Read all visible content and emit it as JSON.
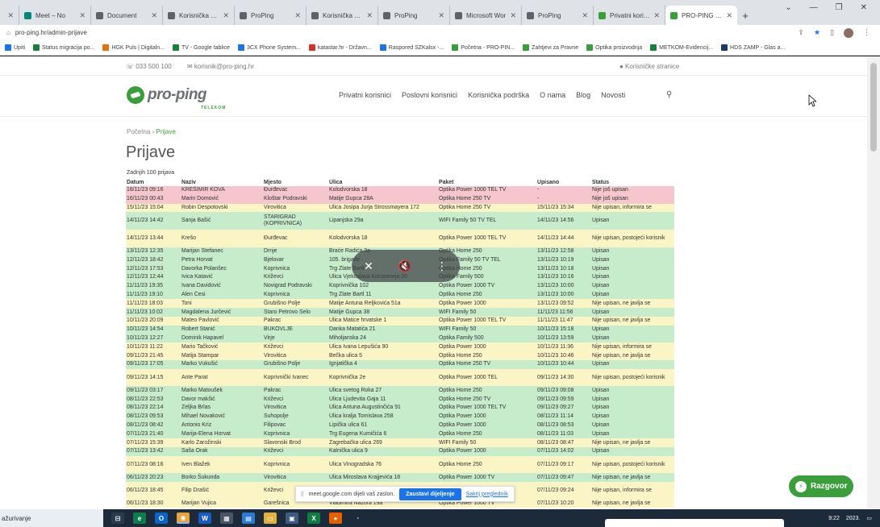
{
  "tabs": [
    {
      "title": "",
      "color": "#5f6368"
    },
    {
      "title": "Meet – No",
      "color": "#00897b"
    },
    {
      "title": "Document",
      "color": "#5f6368"
    },
    {
      "title": "Korisnička pod",
      "color": "#5f6368"
    },
    {
      "title": "ProPing",
      "color": "#5f6368"
    },
    {
      "title": "Korisnička pod",
      "color": "#5f6368"
    },
    {
      "title": "ProPing",
      "color": "#5f6368"
    },
    {
      "title": "Microsoft Wor",
      "color": "#5f6368"
    },
    {
      "title": "ProPing",
      "color": "#5f6368"
    },
    {
      "title": "Privatni korisni",
      "color": "#3a9e3a"
    },
    {
      "title": "PRO-PING Tele",
      "color": "#3a9e3a",
      "active": true
    }
  ],
  "address": {
    "url": "pro-ping.hr/admin-prijave"
  },
  "bookmarks": [
    {
      "label": "Upiti",
      "color": "#1a73e8"
    },
    {
      "label": "Status migracija po...",
      "color": "#188038"
    },
    {
      "label": "HGK Puls | Digitaln...",
      "color": "#e8710a"
    },
    {
      "label": "TV - Google tablice",
      "color": "#188038"
    },
    {
      "label": "3CX Phone System...",
      "color": "#1a73e8"
    },
    {
      "label": "katastar.hr - Državn...",
      "color": "#d93025"
    },
    {
      "label": "Raspored SZKalsx -...",
      "color": "#1a73e8"
    },
    {
      "label": "Početna - PRO-PIN...",
      "color": "#3a9e3a"
    },
    {
      "label": "Zahtjevi za Pravne",
      "color": "#3a9e3a"
    },
    {
      "label": "Optika proizvodnja",
      "color": "#3a9e3a"
    },
    {
      "label": "METKOM-Evidencij...",
      "color": "#188038"
    },
    {
      "label": "HDS ZAMP - Glas a...",
      "color": "#1a3a6a"
    }
  ],
  "topinfo": {
    "phone": "☏ 033 500 100",
    "email": "✉ korisnik@pro-ping.hr",
    "account": "● Korisničke stranice"
  },
  "logo": {
    "word": "pro-ping",
    "sub": "TELEKOM"
  },
  "nav": [
    "Privatni korisnici",
    "Poslovni korisnici",
    "Korisnička podrška",
    "O nama",
    "Blog",
    "Novosti"
  ],
  "breadcrumb": {
    "home": "Početna",
    "sep": "›",
    "current": "Prijave"
  },
  "page_title": "Prijave",
  "count_label": "Zadnjih 100 prijava",
  "columns": [
    "Datum",
    "Naziv",
    "Mjesto",
    "Ulica",
    "Paket",
    "Upisano",
    "Status"
  ],
  "rows": [
    {
      "c": "red",
      "v": [
        "16/11/23 09:16",
        "KREŠIMIR KOVA",
        "Đurđevac",
        "Kolodvorska 18",
        "Optika Power 1000 TEL TV",
        "-",
        "Nije još upisan"
      ]
    },
    {
      "c": "red",
      "v": [
        "16/11/23 00:43",
        "Marin Domović",
        "Kloštar Podravski",
        "Matije Gupca 28A",
        "Optika Home 250 TV",
        "-",
        "Nije još upisan"
      ]
    },
    {
      "c": "yellow",
      "v": [
        "15/11/23 15:04",
        "Robin Despotovski",
        "Virovitica",
        "Ulica Josipa Jurja Strossmayera 172",
        "Optika Home 250 TV",
        "15/11/23 15:34",
        "Nije upisan, informira se"
      ]
    },
    {
      "c": "green",
      "tall": true,
      "v": [
        "14/11/23 14:42",
        "Sanja Bašić",
        "STARIGRAD (KOPRIVNICA)",
        "Lipanjska 29a",
        "WIFI Family 50 TV TEL",
        "14/11/23 14:56",
        "Upisan"
      ]
    },
    {
      "c": "yellow",
      "tall": true,
      "v": [
        "14/11/23 13:44",
        "Krešo",
        "Đurđevac",
        "Kolodvorska 18",
        "Optika Power 1000 TEL TV",
        "14/11/23 14:44",
        "Nije upisan, postojeći korisnik"
      ]
    },
    {
      "c": "green",
      "v": [
        "13/11/23 12:35",
        "Marijan Štefanec",
        "Drnje",
        "Braće Radića 2a",
        "Optika Home 250",
        "13/11/23 12:58",
        "Upisan"
      ]
    },
    {
      "c": "green",
      "v": [
        "12/11/23 18:42",
        "Petra Horvat",
        "Bjelovar",
        "105. brigade",
        "Optika Family 50 TV TEL",
        "13/11/23 10:19",
        "Upisan"
      ]
    },
    {
      "c": "green",
      "v": [
        "12/11/23 17:53",
        "Davorka Polanšec",
        "Koprivnica",
        "Trg Zlate Bartl",
        "Optika Home 250",
        "13/11/23 10:18",
        "Upisan"
      ]
    },
    {
      "c": "green",
      "v": [
        "12/11/23 12:44",
        "Ivica Katavić",
        "Križevci",
        "Ulica Vjekoslava Koroseneja 20",
        "Optika Family 500",
        "13/11/23 10:16",
        "Upisan"
      ]
    },
    {
      "c": "green",
      "v": [
        "11/11/23 19:35",
        "Ivana Davidović",
        "Novigrad Podravski",
        "Koprivnička 102",
        "Optika Power 1000 TV",
        "13/11/23 10:00",
        "Upisan"
      ]
    },
    {
      "c": "green",
      "v": [
        "11/11/23 19:10",
        "Alen Česi",
        "Koprivnica",
        "Trg Zlate Bartl 11",
        "Optika Home 250",
        "13/11/23 10:00",
        "Upisan"
      ]
    },
    {
      "c": "yellow",
      "v": [
        "11/11/23 18:03",
        "Toni",
        "Grubišno Polje",
        "Matije Antuna Reljkovića 51a",
        "Optika Power 1000",
        "13/11/23 09:52",
        "Nije upisan, ne javlja se"
      ]
    },
    {
      "c": "green",
      "v": [
        "11/11/23 10:02",
        "Magdalena Jurčević",
        "Staro Petrovo Selo",
        "Matije Gupca 38",
        "WIFI Family 50",
        "11/11/23 11:56",
        "Upisan"
      ]
    },
    {
      "c": "yellow",
      "v": [
        "10/11/23 20:09",
        "Mateo Pavlović",
        "Pakrac",
        "Ulica Matice hrvatske 1",
        "Optika Power 1000 TEL TV",
        "11/11/23 11:47",
        "Nije upisan, ne javlja se"
      ]
    },
    {
      "c": "green",
      "v": [
        "10/11/23 14:54",
        "Robert Stanić",
        "BUKOVLJE",
        "Danka Matatića 21",
        "WIFI Family 50",
        "10/11/23 15:18",
        "Upisan"
      ]
    },
    {
      "c": "green",
      "v": [
        "10/11/23 12:27",
        "Dominik Hapavel",
        "Virje",
        "Miholjanska 24",
        "Optika Family 500",
        "10/11/23 13:59",
        "Upisan"
      ]
    },
    {
      "c": "yellow",
      "v": [
        "10/11/23 11:22",
        "Mario Tačković",
        "Križevci",
        "Ulica Ivana Lepušića 90",
        "Optika Power 1000",
        "10/11/23 11:36",
        "Nije upisan, informira se"
      ]
    },
    {
      "c": "yellow",
      "v": [
        "09/11/23 21:45",
        "Matija Stampar",
        "Virovitica",
        "Bečka ulica 5",
        "Optika Home 250",
        "10/11/23 10:46",
        "Nije upisan, ne javlja se"
      ]
    },
    {
      "c": "green",
      "v": [
        "09/11/23 17:05",
        "Marko Vukušić",
        "Grubišno Polje",
        "Ignjatička 4",
        "Optika Home 250 TV",
        "10/11/23 10:44",
        "Upisan"
      ]
    },
    {
      "c": "yellow",
      "tall": true,
      "v": [
        "09/11/23 14:15",
        "Ante Parat",
        "Koprivnički Ivanec",
        "Koprivnička 2e",
        "Optika Power 1000 TEL",
        "09/11/23 14:30",
        "Nije upisan, postojeći korisnik"
      ]
    },
    {
      "c": "green",
      "v": [
        "09/11/23 03:17",
        "Marko Matoušek",
        "Pakrac",
        "Ulica svetog Roka 27",
        "Optika Home 250",
        "09/11/23 09:08",
        "Upisan"
      ]
    },
    {
      "c": "green",
      "v": [
        "08/11/23 22:53",
        "Davor makšić",
        "Križevci",
        "Ulica Ljudevita Gaja 11",
        "Optika Home 250 TV",
        "09/11/23 09:59",
        "Upisan"
      ]
    },
    {
      "c": "green",
      "v": [
        "08/11/23 22:14",
        "Zeljka Brlas",
        "Virovitica",
        "Ulica Antuna Augustinčića 91",
        "Optika Power 1000 TEL TV",
        "09/11/23 09:27",
        "Upisan"
      ]
    },
    {
      "c": "green",
      "v": [
        "08/11/23 09:53",
        "Mihael Novaković",
        "Suhopolje",
        "Ulica kralja Tomislava 258",
        "Optika Power 1000",
        "08/11/23 11:14",
        "Upisan"
      ]
    },
    {
      "c": "green",
      "v": [
        "08/11/23 08:42",
        "Antonio Kriz",
        "Filipovac",
        "Lipička ulica 61",
        "Optika Power 1000",
        "08/11/23 08:53",
        "Upisan"
      ]
    },
    {
      "c": "green",
      "v": [
        "07/11/23 21:40",
        "Marija-Elena Horvat",
        "Koprivnica",
        "Trg Eugena Kumičića 6",
        "Optika Home 250",
        "08/11/23 11:03",
        "Upisan"
      ]
    },
    {
      "c": "yellow",
      "v": [
        "07/11/23 15:39",
        "Karlo Zarožinski",
        "Slavonski Brod",
        "Zagrebačka ulica 269",
        "WIFI Family 50",
        "08/11/23 08:47",
        "Nije upisan, ne javlja se"
      ]
    },
    {
      "c": "green",
      "v": [
        "07/11/23 13:42",
        "Saša Orak",
        "Križevci",
        "Kalnička ulica 9",
        "Optika Power 1000",
        "07/11/23 14:02",
        "Upisan"
      ]
    },
    {
      "c": "yellow",
      "tall": true,
      "v": [
        "07/11/23 08:16",
        "Iven Blažek",
        "Koprivnica",
        "Ulica Vinogradska 76",
        "Optika Home 250",
        "07/11/23 09:17",
        "Nije upisan, postojeći korisnik"
      ]
    },
    {
      "c": "green",
      "v": [
        "06/11/23 20:23",
        "Borko Šukunda",
        "Virovitica",
        "Ulica Miroslava Krajjevića 18",
        "Optika Power 1000 TV",
        "07/11/23 09:47",
        "Nije upisan, ne javlja se"
      ]
    },
    {
      "c": "yellow",
      "tall": true,
      "v": [
        "06/11/23 18:45",
        "Filip Drašić",
        "Križevci",
        "",
        "Optika Power 1000",
        "07/11/23 09:24",
        "Nije upisan, informira se"
      ]
    },
    {
      "c": "yellow",
      "v": [
        "06/11/23 18:30",
        "Marijan Vujica",
        "Garešnica",
        "Vladimira Nazora 19a",
        "Optika Power 1000 TV",
        "07/11/23 10:20",
        "Nije upisan, ne javlja se"
      ]
    }
  ],
  "share_bar": {
    "text": "meet.google.com dijeli vaš zaslon.",
    "stop": "Zaustavi dijeljenje",
    "hide": "Sakrij pregledník"
  },
  "chat": {
    "label": "Razgovor"
  },
  "taskbar": {
    "left_label": "ažurivanje",
    "time": "9:22",
    "date": "2023."
  }
}
